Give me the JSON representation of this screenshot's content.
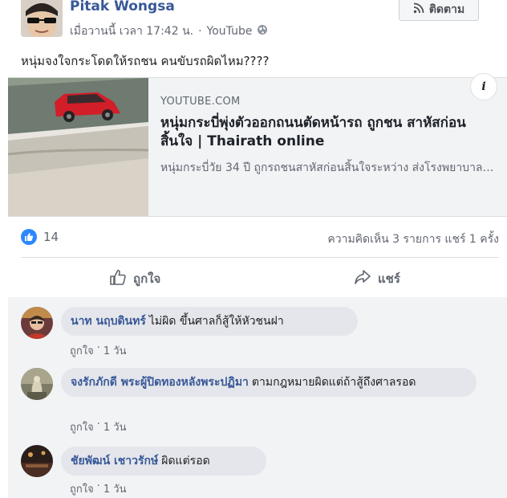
{
  "post": {
    "author": "Pitak Wongsa",
    "timestamp": "เมื่อวานนี้ เวลา 17:42 น.",
    "separator": "·",
    "via": "YouTube",
    "privacy_icon": "globe-icon",
    "follow_label": "ติดตาม",
    "text": "หนุ่มจงใจกระโดดให้รถชน คนขับรถผิดไหม????"
  },
  "link_preview": {
    "source": "YOUTUBE.COM",
    "title": "หนุ่มกระบี่พุ่งตัวออกถนนตัดหน้ารถ ถูกชน สาหัสก่อนสิ้นใจ | Thairath online",
    "description": "หนุ่มกระบี่วัย 34 ปี ถูกรถชนสาหัสก่อนสิ้นใจระหว่าง ส่งโรงพยาบาล…",
    "info_label": "i"
  },
  "stats": {
    "likes": "14",
    "comments_shares": "ความคิดเห็น 3 รายการ  แชร์ 1 ครั้ง"
  },
  "actions": {
    "like_label": "ถูกใจ",
    "share_label": "แชร์"
  },
  "comments": [
    {
      "name": "นาท นฤบดินทร์",
      "text": "ไม่ผิด ขึ้นศาลก็สู้ให้หัวชนฝา",
      "like": "ถูกใจ",
      "sep": "·",
      "time": "1 วัน"
    },
    {
      "name": "จงรักภักดี พระผู้ปิดทองหลังพระปฏิมา",
      "text": "ตามกฎหมายผิดแต่ถ้าสู้ถึงศาลรอด",
      "like": "ถูกใจ",
      "sep": "·",
      "time": "1 วัน"
    },
    {
      "name": "ชัยพัฒน์ เชาวรักษ์",
      "text": "ผิดแต่รอด",
      "like": "ถูกใจ",
      "sep": "·",
      "time": "1 วัน"
    }
  ],
  "colors": {
    "name_blue": "#385898",
    "like_blue": "#2d88ff",
    "panel_gray": "#f2f3f5",
    "bubble_gray": "#e4e6eb"
  }
}
